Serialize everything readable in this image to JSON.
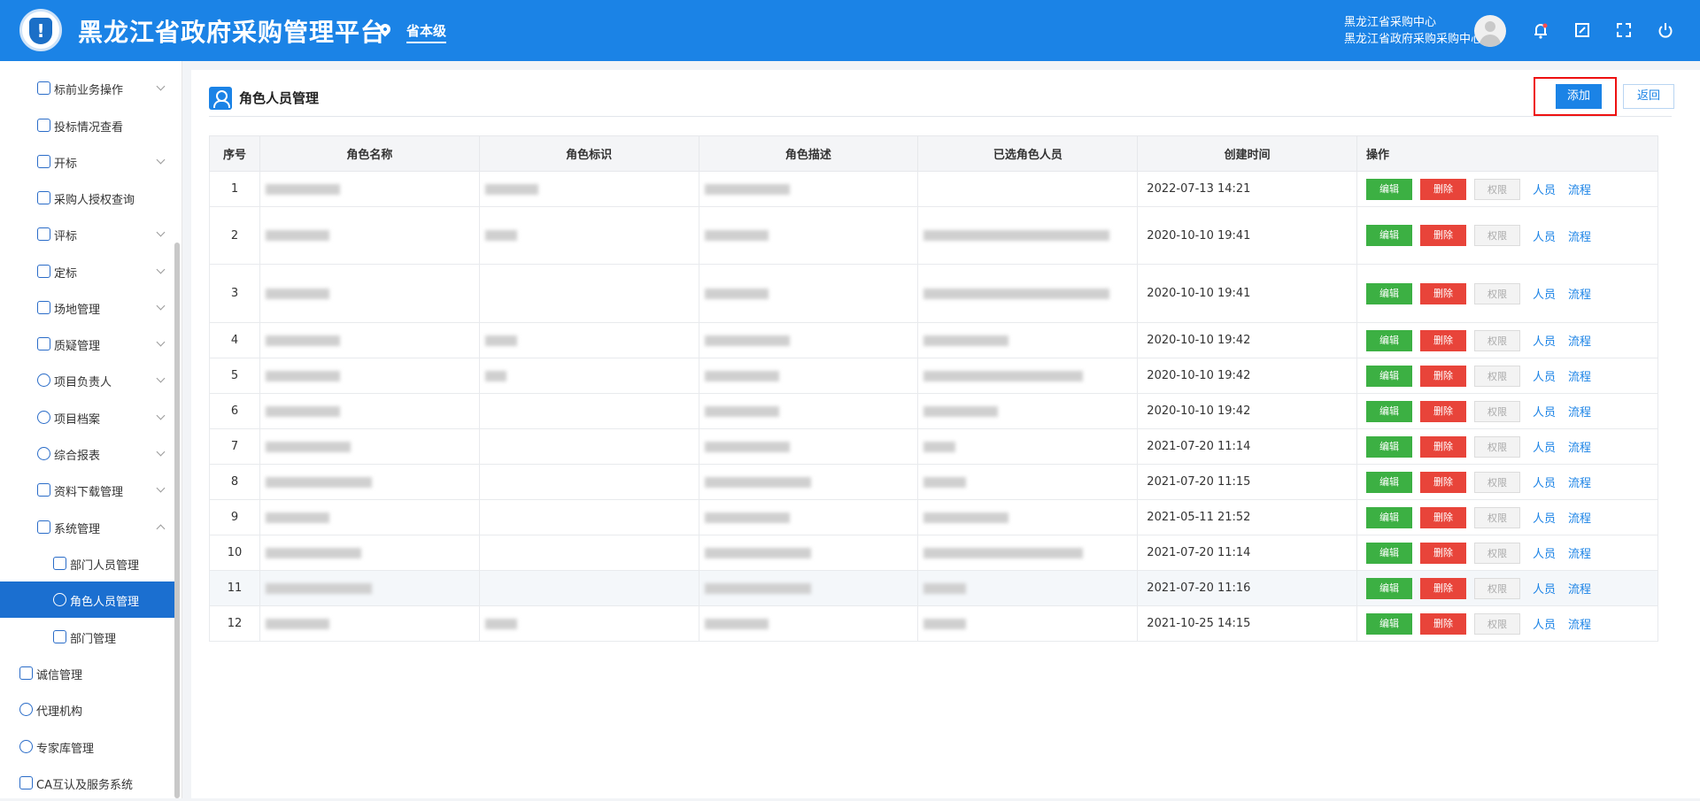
{
  "header": {
    "title": "黑龙江省政府采购管理平台",
    "region": "省本级",
    "user_line1": "黑龙江省采购中心",
    "user_line2": "黑龙江省政府采购采购中心",
    "icons": [
      "notification-icon",
      "screen-icon",
      "fullscreen-icon",
      "power-icon"
    ]
  },
  "sidebar": {
    "items": [
      {
        "label": "标前业务操作",
        "icon": "cart-icon"
      },
      {
        "label": "投标情况查看",
        "icon": "search-doc-icon"
      },
      {
        "label": "开标",
        "icon": "open-bid-icon"
      },
      {
        "label": "采购人授权查询",
        "icon": "shield-icon"
      },
      {
        "label": "评标",
        "icon": "evaluate-icon"
      },
      {
        "label": "定标",
        "icon": "award-icon"
      },
      {
        "label": "场地管理",
        "icon": "venue-icon"
      },
      {
        "label": "质疑管理",
        "icon": "question-icon"
      },
      {
        "label": "项目负责人",
        "icon": "person-icon"
      },
      {
        "label": "项目档案",
        "icon": "archive-icon"
      },
      {
        "label": "综合报表",
        "icon": "report-icon"
      },
      {
        "label": "资料下载管理",
        "icon": "link-icon"
      },
      {
        "label": "系统管理",
        "icon": "shield-icon"
      },
      {
        "label": "部门人员管理",
        "icon": "shield-icon"
      },
      {
        "label": "角色人员管理",
        "icon": "user-icon"
      },
      {
        "label": "部门管理",
        "icon": "org-icon"
      },
      {
        "label": "诚信管理",
        "icon": "list-icon"
      },
      {
        "label": "代理机构",
        "icon": "agency-icon"
      },
      {
        "label": "专家库管理",
        "icon": "gear-icon"
      },
      {
        "label": "CA互认及服务系统",
        "icon": "ca-icon"
      }
    ]
  },
  "main": {
    "page_title": "角色人员管理",
    "add_label": "添加",
    "back_label": "返回",
    "columns": [
      "序号",
      "角色名称",
      "角色标识",
      "角色描述",
      "已选角色人员",
      "创建时间",
      "操作"
    ],
    "action_labels": {
      "edit": "编辑",
      "delete": "删除",
      "perm": "权限",
      "people": "人员",
      "flow": "流程"
    },
    "rows": [
      {
        "seq": "1",
        "time": "2022-07-13 14:21"
      },
      {
        "seq": "2",
        "time": "2020-10-10 19:41"
      },
      {
        "seq": "3",
        "time": "2020-10-10 19:41"
      },
      {
        "seq": "4",
        "time": "2020-10-10 19:42"
      },
      {
        "seq": "5",
        "time": "2020-10-10 19:42"
      },
      {
        "seq": "6",
        "time": "2020-10-10 19:42"
      },
      {
        "seq": "7",
        "time": "2021-07-20 11:14"
      },
      {
        "seq": "8",
        "time": "2021-07-20 11:15"
      },
      {
        "seq": "9",
        "time": "2021-05-11 21:52"
      },
      {
        "seq": "10",
        "time": "2021-07-20 11:14"
      },
      {
        "seq": "11",
        "time": "2021-07-20 11:16"
      },
      {
        "seq": "12",
        "time": "2021-10-25 14:15"
      }
    ]
  }
}
